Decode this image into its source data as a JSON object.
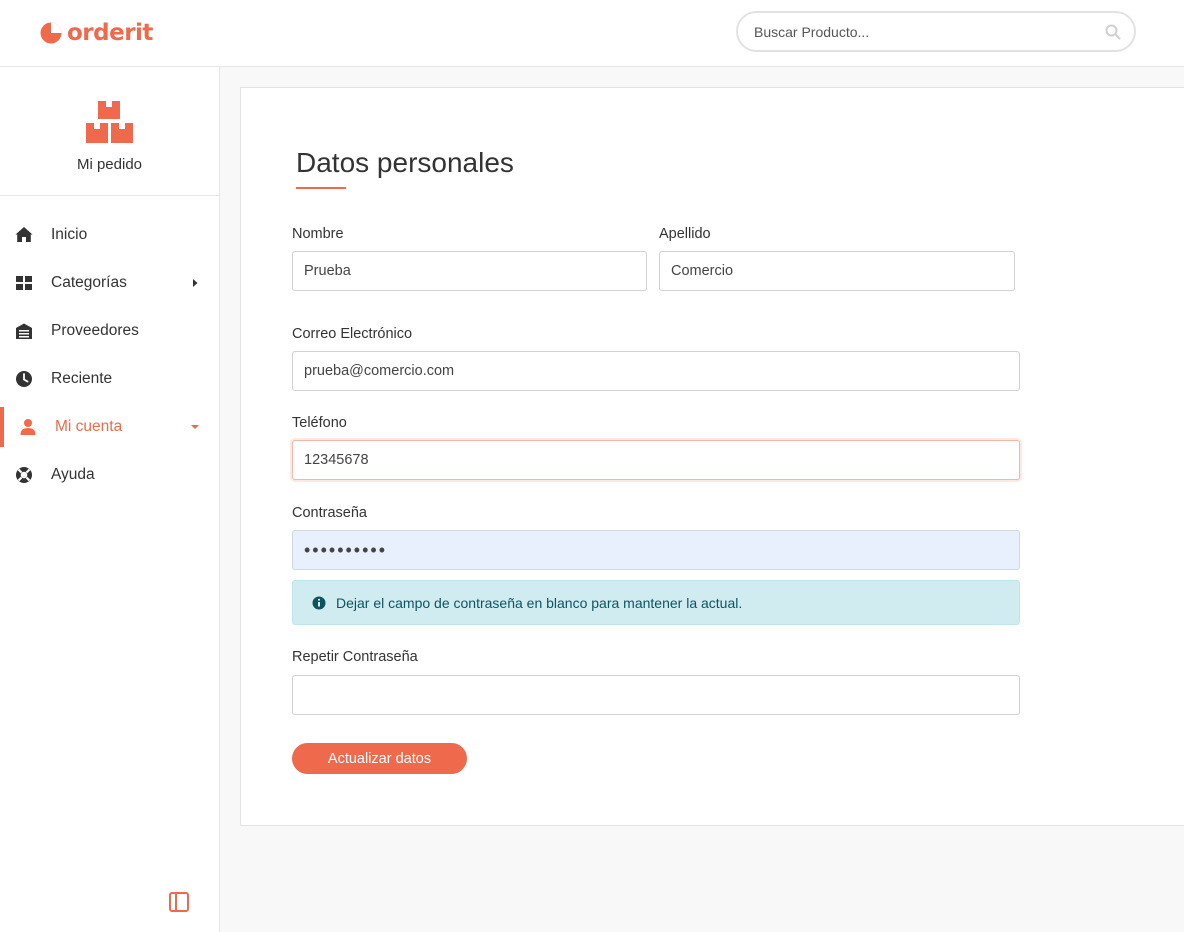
{
  "brand": {
    "name": "orderit",
    "color": "#ef6a4c"
  },
  "search": {
    "placeholder": "Buscar Producto...",
    "value": "",
    "icon": "search-icon"
  },
  "sidebar": {
    "order": {
      "label": "Mi pedido",
      "icon": "boxes-icon"
    },
    "items": [
      {
        "label": "Inicio",
        "icon": "home-icon",
        "arrow": "none",
        "active": false
      },
      {
        "label": "Categorías",
        "icon": "grid-icon",
        "arrow": "right",
        "active": false
      },
      {
        "label": "Proveedores",
        "icon": "warehouse-icon",
        "arrow": "none",
        "active": false
      },
      {
        "label": "Reciente",
        "icon": "clock-icon",
        "arrow": "none",
        "active": false
      },
      {
        "label": "Mi cuenta",
        "icon": "user-icon",
        "arrow": "down",
        "active": true
      },
      {
        "label": "Ayuda",
        "icon": "lifebuoy-icon",
        "arrow": "none",
        "active": false
      }
    ],
    "collapse_icon": "sidebar-toggle-icon"
  },
  "form": {
    "title": "Datos personales",
    "nombre": {
      "label": "Nombre",
      "value": "Prueba"
    },
    "apellido": {
      "label": "Apellido",
      "value": "Comercio"
    },
    "email": {
      "label": "Correo Electrónico",
      "value": "prueba@comercio.com"
    },
    "telefono": {
      "label": "Teléfono",
      "value": "12345678"
    },
    "password": {
      "label": "Contraseña",
      "value": "••••••••••"
    },
    "password_hint": "Dejar el campo de contraseña en blanco para mantener la actual.",
    "repeat_password": {
      "label": "Repetir Contraseña",
      "value": ""
    },
    "submit_label": "Actualizar datos"
  }
}
